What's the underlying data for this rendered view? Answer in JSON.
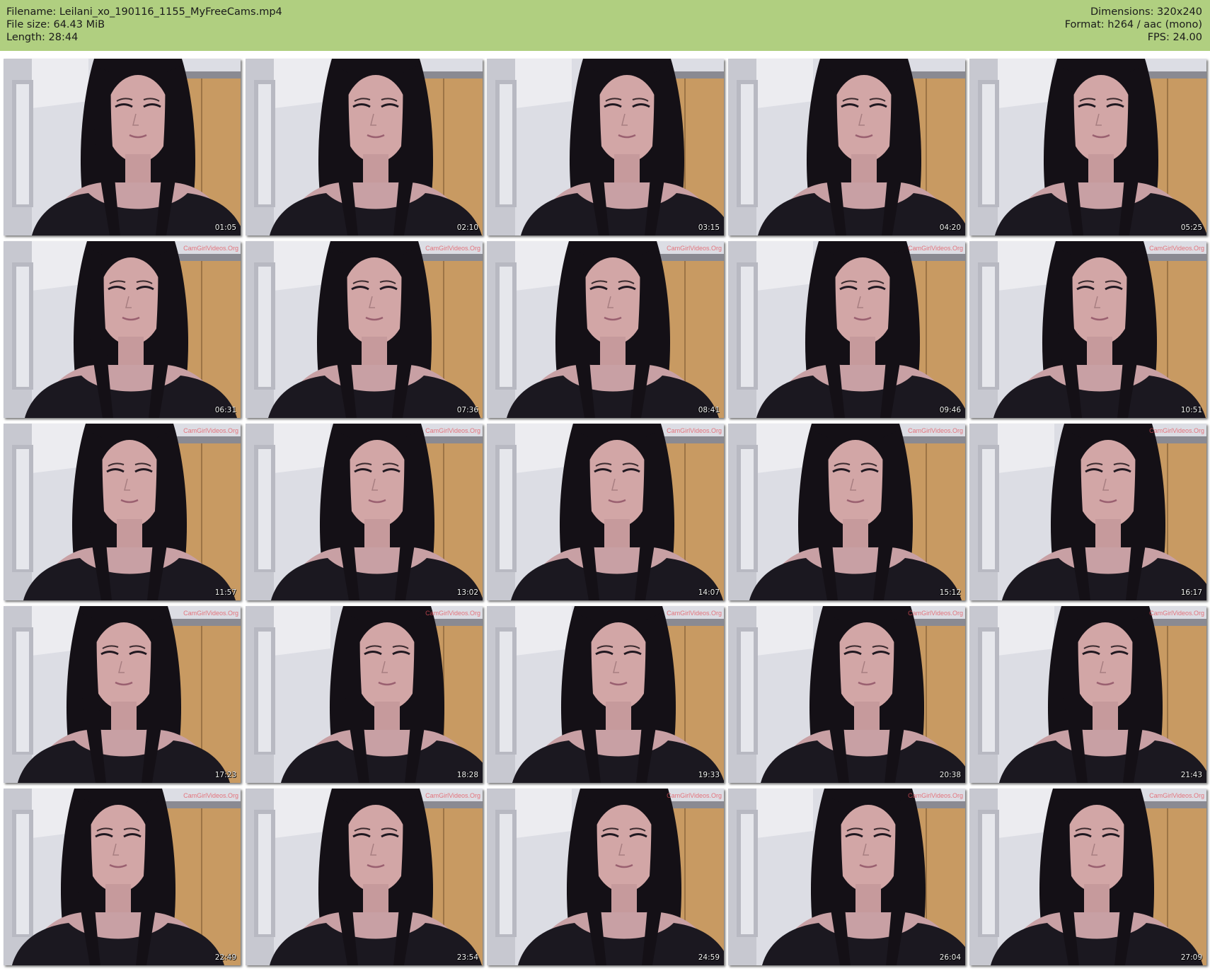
{
  "header": {
    "filename": "Filename: Leilani_xo_190116_1155_MyFreeCams.mp4",
    "filesize": "File size: 64.43 MiB",
    "length": "Length: 28:44",
    "dimensions": "Dimensions: 320x240",
    "format": "Format: h264 / aac (mono)",
    "fps": "FPS: 24.00"
  },
  "watermark": "CamGirlVideos.Org",
  "thumbnails": [
    {
      "time": "01:05"
    },
    {
      "time": "02:10"
    },
    {
      "time": "03:15"
    },
    {
      "time": "04:20"
    },
    {
      "time": "05:25"
    },
    {
      "time": "06:31"
    },
    {
      "time": "07:36"
    },
    {
      "time": "08:41"
    },
    {
      "time": "09:46"
    },
    {
      "time": "10:51"
    },
    {
      "time": "11:57"
    },
    {
      "time": "13:02"
    },
    {
      "time": "14:07"
    },
    {
      "time": "15:12"
    },
    {
      "time": "16:17"
    },
    {
      "time": "17:23"
    },
    {
      "time": "18:28"
    },
    {
      "time": "19:33"
    },
    {
      "time": "20:38"
    },
    {
      "time": "21:43"
    },
    {
      "time": "22:49"
    },
    {
      "time": "23:54"
    },
    {
      "time": "24:59"
    },
    {
      "time": "26:04"
    },
    {
      "time": "27:09"
    }
  ],
  "colors": {
    "header_bg": "#b0cf80",
    "wall": "#dcdde4",
    "cabinet": "#c89a62",
    "skin": "#d2a6a6",
    "hair": "#141016",
    "shirt": "#1b1820"
  }
}
